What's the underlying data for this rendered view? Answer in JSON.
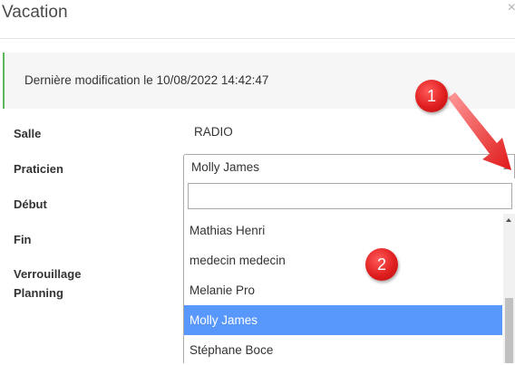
{
  "modal": {
    "title": "Vacation",
    "close_glyph": "×"
  },
  "info": {
    "last_modified": "Dernière modification le 10/08/2022 14:42:47"
  },
  "form": {
    "salle_label": "Salle",
    "salle_value": "RADIO",
    "praticien_label": "Praticien",
    "debut_label": "Début",
    "fin_label": "Fin",
    "verrouillage_label_1": "Verrouillage",
    "verrouillage_label_2": "Planning"
  },
  "select": {
    "selected": "Molly James",
    "search_value": "",
    "options": [
      "Mathias Henri",
      "medecin medecin",
      "Melanie Pro",
      "Molly James",
      "Stéphane Boce"
    ],
    "selected_index": 3
  },
  "annotations": {
    "badge_1": "1",
    "badge_2": "2"
  },
  "colors": {
    "accent_green": "#5cb85c",
    "selected_blue": "#5897fb",
    "badge_red": "#e01f1f"
  }
}
